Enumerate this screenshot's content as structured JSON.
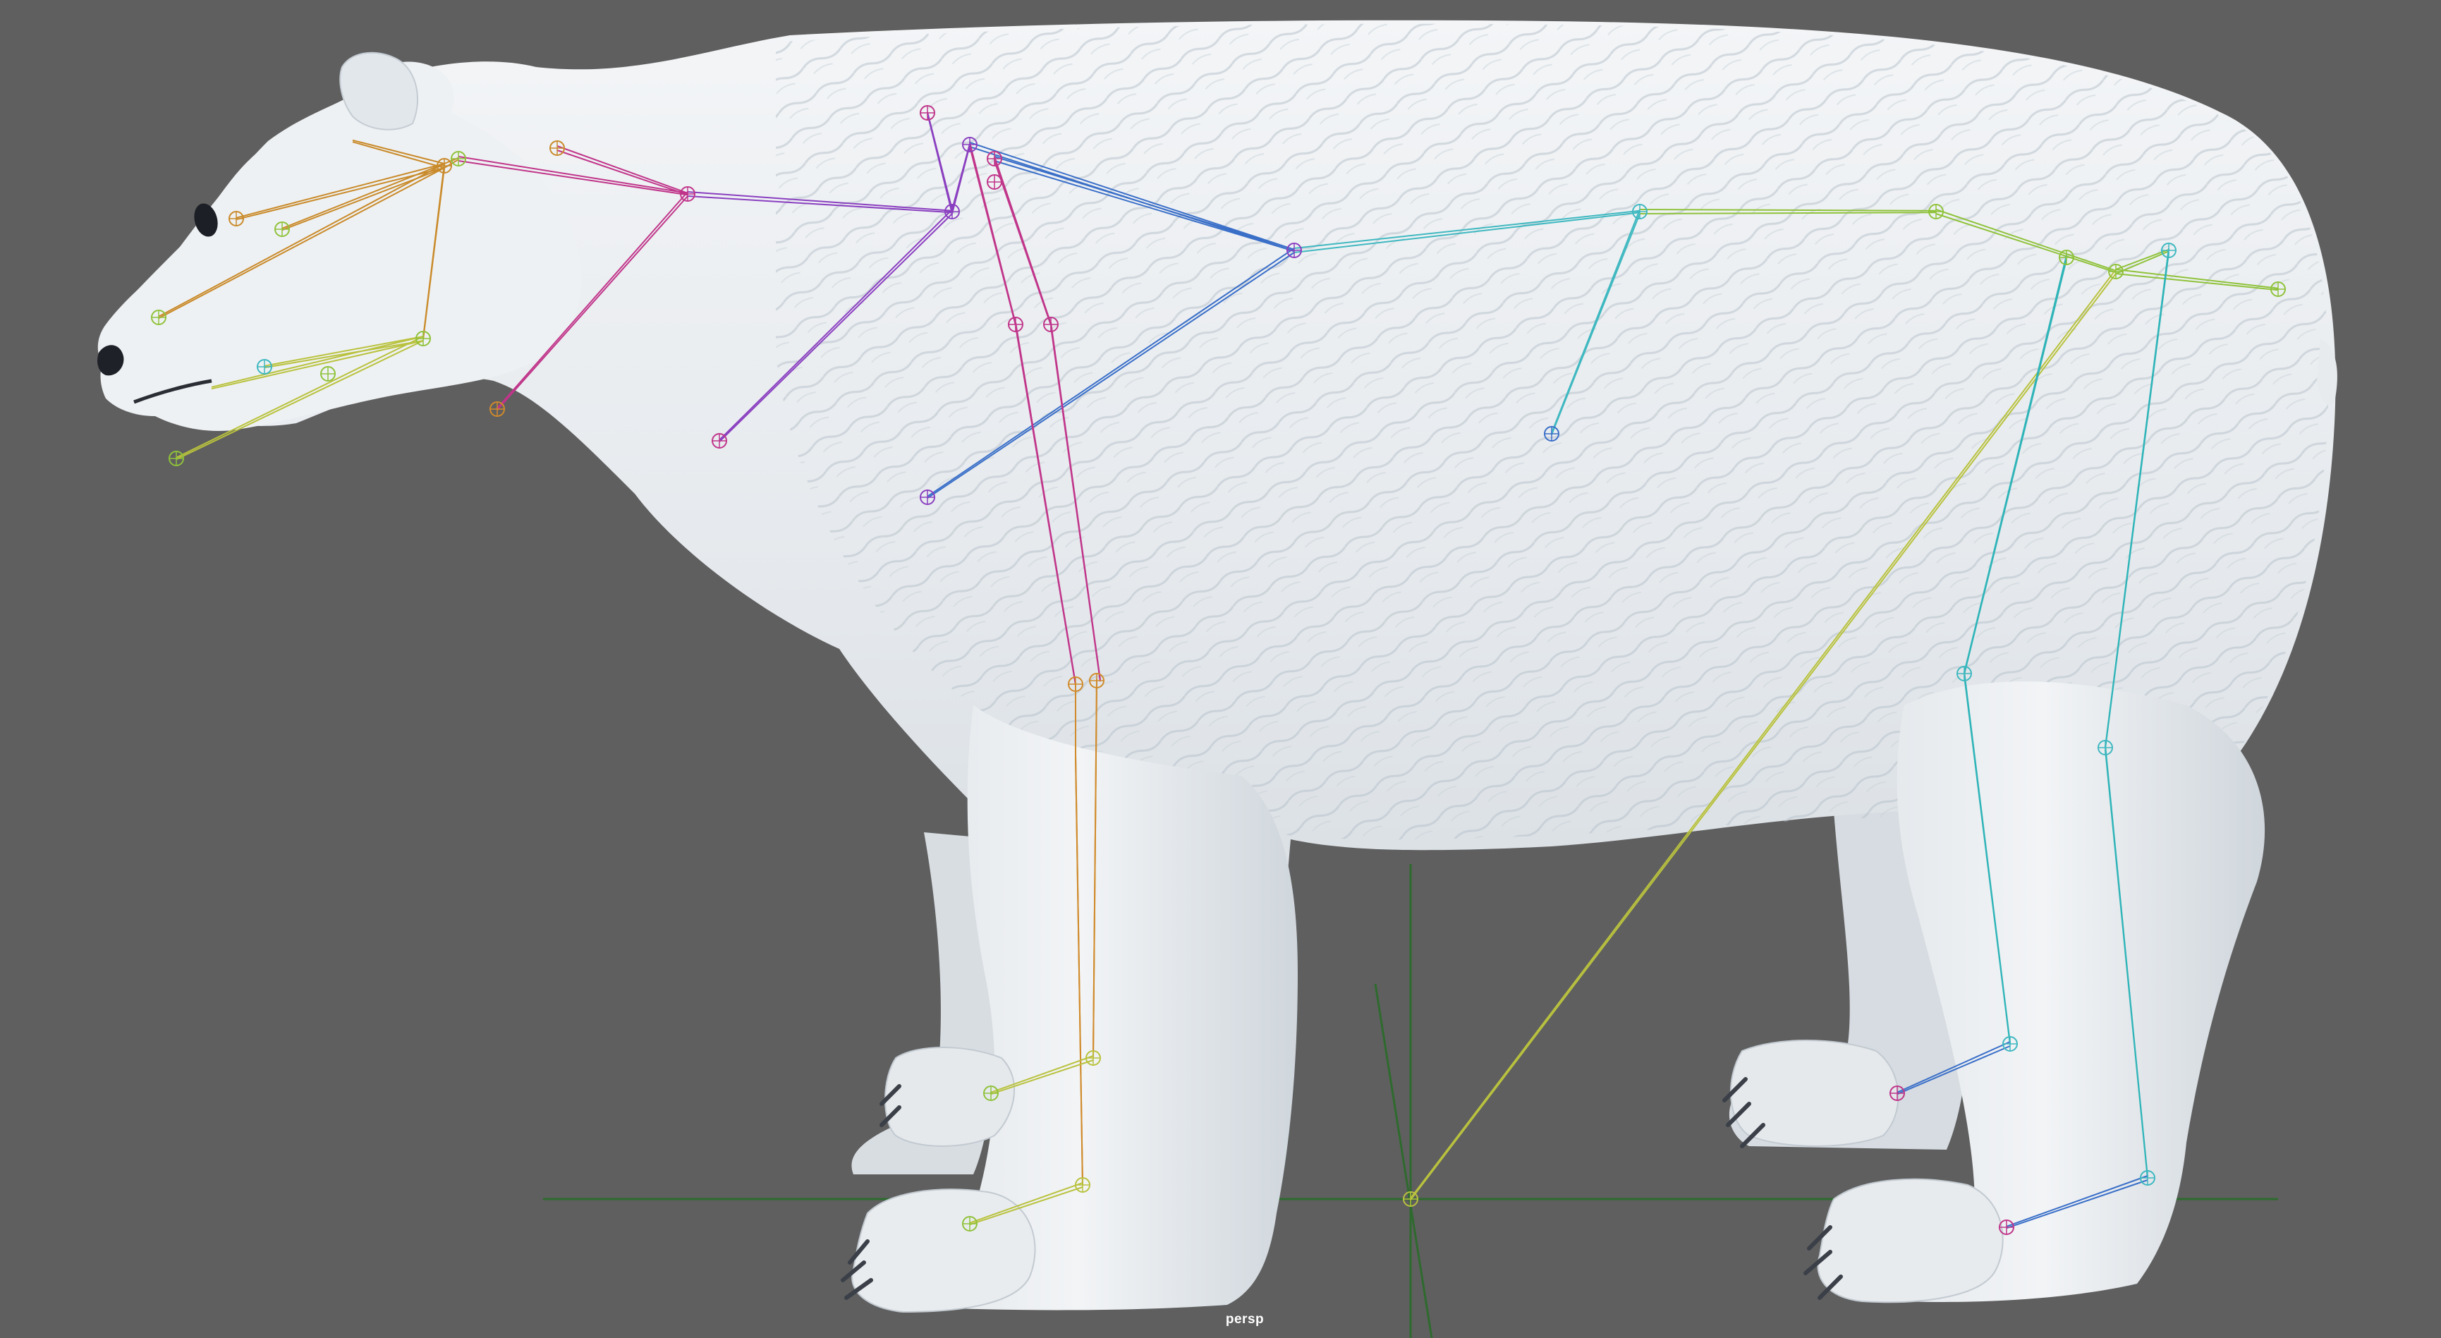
{
  "viewport": {
    "camera_label": "persp",
    "background_color": "#5f5f5f",
    "grid_color": "#2e6a2e"
  },
  "model": {
    "fur_color": "#eceff2",
    "fur_shadow_color": "#bcc6ce",
    "claw_color": "#3a3f48"
  },
  "skeleton_colors": {
    "head": "#c98a2a",
    "jaw": "#b9c23e",
    "neck": "#c0358a",
    "shoulder": "#8a3fc0",
    "spine": "#3a6fc8",
    "back": "#3fb8c0",
    "hip": "#8fc23a",
    "front_leg": "#c0358a",
    "front_leg_lower": "#d08a2a",
    "foot": "#b9c23e",
    "hind_leg": "#2fb4b8",
    "hind_foot": "#3a6fc8"
  }
}
